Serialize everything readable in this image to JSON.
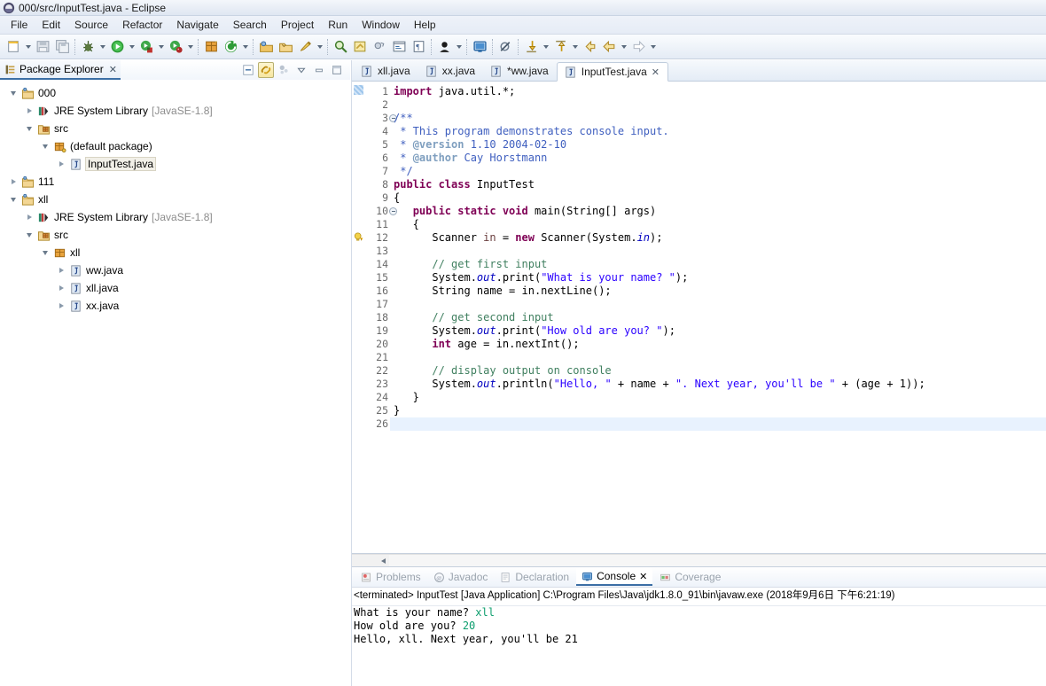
{
  "window": {
    "title": "000/src/InputTest.java - Eclipse",
    "icon": "eclipse-icon"
  },
  "menubar": {
    "items": [
      {
        "label": "File",
        "name": "menu-file"
      },
      {
        "label": "Edit",
        "name": "menu-edit"
      },
      {
        "label": "Source",
        "name": "menu-source"
      },
      {
        "label": "Refactor",
        "name": "menu-refactor"
      },
      {
        "label": "Navigate",
        "name": "menu-navigate"
      },
      {
        "label": "Search",
        "name": "menu-search"
      },
      {
        "label": "Project",
        "name": "menu-project"
      },
      {
        "label": "Run",
        "name": "menu-run"
      },
      {
        "label": "Window",
        "name": "menu-window"
      },
      {
        "label": "Help",
        "name": "menu-help"
      }
    ]
  },
  "toolbar": {
    "items": [
      {
        "icon": "new-wizard-icon",
        "dropdown": true
      },
      {
        "icon": "save-icon",
        "dropdown": false
      },
      {
        "icon": "save-all-icon",
        "dropdown": false
      },
      {
        "sep": true
      },
      {
        "icon": "debug-icon",
        "dropdown": true
      },
      {
        "icon": "run-icon",
        "dropdown": true
      },
      {
        "icon": "coverage-icon",
        "dropdown": true
      },
      {
        "icon": "profile-icon",
        "dropdown": true
      },
      {
        "sep": true
      },
      {
        "icon": "new-java-package-icon",
        "dropdown": false
      },
      {
        "icon": "external-tools-icon",
        "dropdown": true
      },
      {
        "sep": true
      },
      {
        "icon": "open-type-icon",
        "dropdown": false
      },
      {
        "icon": "open-resource-icon",
        "dropdown": false
      },
      {
        "icon": "quick-access-icon",
        "dropdown": true
      },
      {
        "sep": true
      },
      {
        "icon": "search-icon",
        "dropdown": false
      },
      {
        "icon": "toggle-mark-occurrences-icon",
        "dropdown": false
      },
      {
        "icon": "new-class-icon",
        "dropdown": false
      },
      {
        "icon": "terminal-icon",
        "dropdown": false
      },
      {
        "icon": "pilcrow-icon",
        "dropdown": false
      },
      {
        "sep": true
      },
      {
        "icon": "perspective-icon",
        "dropdown": true
      },
      {
        "sep": true
      },
      {
        "icon": "console-icon",
        "dropdown": false
      },
      {
        "sep": true
      },
      {
        "icon": "skip-breakpoints-icon",
        "dropdown": false
      },
      {
        "sep": true
      },
      {
        "icon": "step-into-icon",
        "dropdown": true
      },
      {
        "icon": "step-return-icon",
        "dropdown": true
      },
      {
        "icon": "previous-annotation-icon",
        "dropdown": false
      },
      {
        "icon": "back-icon",
        "dropdown": true
      },
      {
        "icon": "forward-icon",
        "dropdown": true
      }
    ]
  },
  "explorer": {
    "tab_label": "Package Explorer",
    "close_glyph": "✕",
    "toolbar_icons": [
      "collapse-all-icon",
      "link-with-editor-icon",
      "focus-on-active-task-icon",
      "view-menu-icon",
      "minimize-icon",
      "maximize-icon"
    ],
    "tree": [
      {
        "depth": 0,
        "twist": "open",
        "icon": "java-project-icon",
        "label": "000",
        "dim": "",
        "selected": false,
        "name": "tree-item-project-000"
      },
      {
        "depth": 1,
        "twist": "closed",
        "icon": "jre-library-icon",
        "label": "JRE System Library",
        "dim": "[JavaSE-1.8]",
        "selected": false,
        "name": "tree-item-jre-000"
      },
      {
        "depth": 1,
        "twist": "open",
        "icon": "source-folder-icon",
        "label": "src",
        "dim": "",
        "selected": false,
        "name": "tree-item-src-000"
      },
      {
        "depth": 2,
        "twist": "open",
        "icon": "package-icon",
        "label": "(default package)",
        "dim": "",
        "selected": false,
        "name": "tree-item-default-package"
      },
      {
        "depth": 3,
        "twist": "closed",
        "icon": "java-file-icon",
        "label": "InputTest.java",
        "dim": "",
        "selected": true,
        "name": "tree-item-inputtest-java"
      },
      {
        "depth": 0,
        "twist": "closed",
        "icon": "java-project-icon",
        "label": "111",
        "dim": "",
        "selected": false,
        "name": "tree-item-project-111"
      },
      {
        "depth": 0,
        "twist": "open",
        "icon": "java-project-icon",
        "label": "xll",
        "dim": "",
        "selected": false,
        "name": "tree-item-project-xll"
      },
      {
        "depth": 1,
        "twist": "closed",
        "icon": "jre-library-icon",
        "label": "JRE System Library",
        "dim": "[JavaSE-1.8]",
        "selected": false,
        "name": "tree-item-jre-xll"
      },
      {
        "depth": 1,
        "twist": "open",
        "icon": "source-folder-icon",
        "label": "src",
        "dim": "",
        "selected": false,
        "name": "tree-item-src-xll"
      },
      {
        "depth": 2,
        "twist": "open",
        "icon": "package-plain-icon",
        "label": "xll",
        "dim": "",
        "selected": false,
        "name": "tree-item-package-xll"
      },
      {
        "depth": 3,
        "twist": "closed",
        "icon": "java-file-icon",
        "label": "ww.java",
        "dim": "",
        "selected": false,
        "name": "tree-item-ww-java"
      },
      {
        "depth": 3,
        "twist": "closed",
        "icon": "java-file-icon",
        "label": "xll.java",
        "dim": "",
        "selected": false,
        "name": "tree-item-xll-java"
      },
      {
        "depth": 3,
        "twist": "closed",
        "icon": "java-file-icon",
        "label": "xx.java",
        "dim": "",
        "selected": false,
        "name": "tree-item-xx-java"
      }
    ]
  },
  "editor": {
    "tabs": [
      {
        "label": "xll.java",
        "active": false,
        "dirty": false,
        "name": "editor-tab-xll-java"
      },
      {
        "label": "xx.java",
        "active": false,
        "dirty": false,
        "name": "editor-tab-xx-java"
      },
      {
        "label": "*ww.java",
        "active": false,
        "dirty": true,
        "name": "editor-tab-ww-java"
      },
      {
        "label": "InputTest.java",
        "active": true,
        "dirty": false,
        "name": "editor-tab-inputtest-java"
      }
    ],
    "close_glyph": "✕",
    "current_line": 26,
    "fold_lines": [
      3,
      10
    ],
    "warning_line": 12,
    "lines": [
      {
        "n": 1,
        "html": "<span class=\"kw\">import</span> java.util.*;"
      },
      {
        "n": 2,
        "html": ""
      },
      {
        "n": 3,
        "html": "<span class=\"jdoc\">/**</span>"
      },
      {
        "n": 4,
        "html": "<span class=\"jdoc\"> * This program demonstrates console input.</span>"
      },
      {
        "n": 5,
        "html": "<span class=\"jdoc\"> * </span><span class=\"jtag\">@version</span><span class=\"jdoc\"> 1.10 2004-02-10</span>"
      },
      {
        "n": 6,
        "html": "<span class=\"jdoc\"> * </span><span class=\"jtag\">@author</span><span class=\"jdoc\"> Cay Horstmann</span>"
      },
      {
        "n": 7,
        "html": "<span class=\"jdoc\"> */</span>"
      },
      {
        "n": 8,
        "html": "<span class=\"kw\">public class</span> InputTest"
      },
      {
        "n": 9,
        "html": "{"
      },
      {
        "n": 10,
        "html": "   <span class=\"kw\">public static void</span> main(String[] args)"
      },
      {
        "n": 11,
        "html": "   {"
      },
      {
        "n": 12,
        "html": "      Scanner <span class=\"loc\">in</span> = <span class=\"kw\">new</span> Scanner(System.<span class=\"fld\">in</span>);"
      },
      {
        "n": 13,
        "html": ""
      },
      {
        "n": 14,
        "html": "      <span class=\"cmt\">// get first input</span>"
      },
      {
        "n": 15,
        "html": "      System.<span class=\"fld\">out</span>.print(<span class=\"str\">\"What is your name? \"</span>);"
      },
      {
        "n": 16,
        "html": "      String name = in.nextLine();"
      },
      {
        "n": 17,
        "html": ""
      },
      {
        "n": 18,
        "html": "      <span class=\"cmt\">// get second input</span>"
      },
      {
        "n": 19,
        "html": "      System.<span class=\"fld\">out</span>.print(<span class=\"str\">\"How old are you? \"</span>);"
      },
      {
        "n": 20,
        "html": "      <span class=\"kw\">int</span> age = in.nextInt();"
      },
      {
        "n": 21,
        "html": ""
      },
      {
        "n": 22,
        "html": "      <span class=\"cmt\">// display output on console</span>"
      },
      {
        "n": 23,
        "html": "      System.<span class=\"fld\">out</span>.println(<span class=\"str\">\"Hello, \"</span> + name + <span class=\"str\">\". Next year, you'll be \"</span> + (age + 1));"
      },
      {
        "n": 24,
        "html": "   }"
      },
      {
        "n": 25,
        "html": "}"
      },
      {
        "n": 26,
        "html": ""
      }
    ]
  },
  "console": {
    "tabs": [
      {
        "label": "Problems",
        "active": false,
        "icon": "problems-icon",
        "name": "console-tab-problems"
      },
      {
        "label": "Javadoc",
        "active": false,
        "icon": "javadoc-icon",
        "name": "console-tab-javadoc"
      },
      {
        "label": "Declaration",
        "active": false,
        "icon": "declaration-icon",
        "name": "console-tab-declaration"
      },
      {
        "label": "Console",
        "active": true,
        "icon": "console-icon",
        "name": "console-tab-console"
      },
      {
        "label": "Coverage",
        "active": false,
        "icon": "coverage-icon",
        "name": "console-tab-coverage"
      }
    ],
    "close_glyph": "✕",
    "terminated_line": "<terminated> InputTest [Java Application] C:\\Program Files\\Java\\jdk1.8.0_91\\bin\\javaw.exe (2018年9月6日 下午6:21:19)",
    "output": [
      {
        "prompt": "What is your name? ",
        "input": "xll"
      },
      {
        "prompt": "How old are you? ",
        "input": "20"
      },
      {
        "prompt": "Hello, xll. Next year, you'll be 21",
        "input": ""
      }
    ]
  },
  "colors": {
    "keyword": "#7f0055",
    "string": "#2a00ff",
    "comment": "#3f7f5f",
    "javadoc": "#3f5fbf",
    "field": "#0000c0",
    "tab_underline": "#3b6ea5",
    "console_input": "#0e9e6e",
    "current_line": "#e8f2fe"
  }
}
